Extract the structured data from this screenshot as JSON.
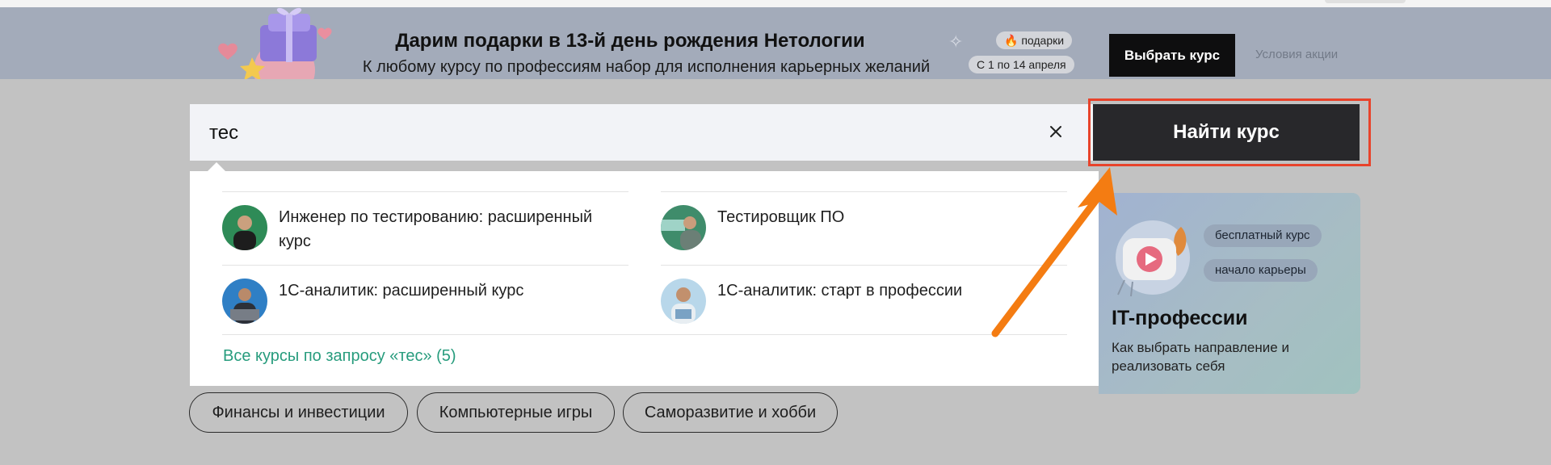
{
  "banner": {
    "title": "Дарим подарки в 13-й день рождения Нетологии",
    "subtitle": "К любому курсу по профессиям набор для исполнения карьерных желаний",
    "tag_gifts": "🔥 подарки",
    "tag_dates": "С 1 по 14 апреля",
    "cta_label": "Выбрать курс",
    "terms_link": "Условия акции"
  },
  "search": {
    "value": "тес",
    "submit_label": "Найти курс"
  },
  "suggestions": {
    "items": [
      {
        "title": "Инженер по тестированию: расширенный курс"
      },
      {
        "title": "Тестировщик ПО"
      },
      {
        "title": "1С-аналитик: расширенный курс"
      },
      {
        "title": "1С-аналитик: старт в профессии"
      }
    ],
    "all_link": "Все курсы по запросу «тес» (5)"
  },
  "promo_card": {
    "chip_free": "бесплатный курс",
    "chip_start": "начало карьеры",
    "title": "IT-профессии",
    "description": "Как выбрать направление и реализовать себя"
  },
  "categories": [
    "Финансы и инвестиции",
    "Компьютерные игры",
    "Саморазвитие и хобби"
  ],
  "colors": {
    "overlay": "#c2c2c2",
    "banner_bg": "#a3abba",
    "accent_green": "#279c7d",
    "highlight_red": "#e8432b",
    "arrow_orange": "#f47c12"
  }
}
